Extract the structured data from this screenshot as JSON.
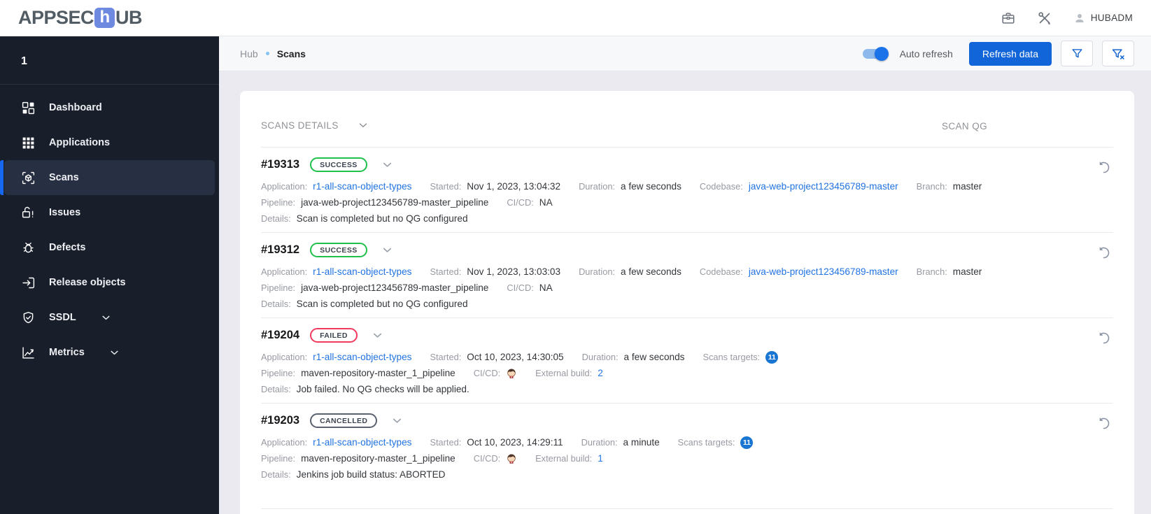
{
  "header": {
    "logo_pre": "APPSEC",
    "logo_mid": "h",
    "logo_post": "UB",
    "user": "HUBADM"
  },
  "sidebar": {
    "workspace": "1",
    "items": [
      {
        "label": "Dashboard",
        "icon": "dashboard-icon",
        "active": false,
        "expandable": false
      },
      {
        "label": "Applications",
        "icon": "applications-icon",
        "active": false,
        "expandable": false
      },
      {
        "label": "Scans",
        "icon": "scans-icon",
        "active": true,
        "expandable": false
      },
      {
        "label": "Issues",
        "icon": "issues-icon",
        "active": false,
        "expandable": false
      },
      {
        "label": "Defects",
        "icon": "defects-icon",
        "active": false,
        "expandable": false
      },
      {
        "label": "Release objects",
        "icon": "release-objects-icon",
        "active": false,
        "expandable": false
      },
      {
        "label": "SSDL",
        "icon": "ssdl-icon",
        "active": false,
        "expandable": true
      },
      {
        "label": "Metrics",
        "icon": "metrics-icon",
        "active": false,
        "expandable": true
      }
    ]
  },
  "topbar": {
    "breadcrumb_root": "Hub",
    "breadcrumb_current": "Scans",
    "auto_refresh_label": "Auto refresh",
    "auto_refresh_on": true,
    "refresh_button": "Refresh data"
  },
  "colors": {
    "accent_blue": "#1165d8",
    "link_blue": "#2173e2",
    "success": "#1fc14b",
    "failed": "#f23a5e",
    "cancelled": "#59626e",
    "targets_badge": "#1976d2"
  },
  "table": {
    "header_left": "SCANS DETAILS",
    "header_right": "SCAN QG",
    "rows": [
      {
        "id": "#19313",
        "status": "SUCCESS",
        "status_type": "success",
        "line1": [
          {
            "label": "Application:",
            "value": "r1-all-scan-object-types",
            "type": "link"
          },
          {
            "label": "Started:",
            "value": "Nov 1, 2023, 13:04:32",
            "type": "text"
          },
          {
            "label": "Duration:",
            "value": "a few seconds",
            "type": "text"
          },
          {
            "label": "Codebase:",
            "value": "java-web-project123456789-master",
            "type": "link"
          },
          {
            "label": "Branch:",
            "value": "master",
            "type": "text"
          }
        ],
        "line2": [
          {
            "label": "Pipeline:",
            "value": "java-web-project123456789-master_pipeline",
            "type": "text"
          },
          {
            "label": "CI/CD:",
            "value": "NA",
            "type": "text"
          }
        ],
        "details": {
          "label": "Details:",
          "value": "Scan is completed but no QG configured"
        }
      },
      {
        "id": "#19312",
        "status": "SUCCESS",
        "status_type": "success",
        "line1": [
          {
            "label": "Application:",
            "value": "r1-all-scan-object-types",
            "type": "link"
          },
          {
            "label": "Started:",
            "value": "Nov 1, 2023, 13:03:03",
            "type": "text"
          },
          {
            "label": "Duration:",
            "value": "a few seconds",
            "type": "text"
          },
          {
            "label": "Codebase:",
            "value": "java-web-project123456789-master",
            "type": "link"
          },
          {
            "label": "Branch:",
            "value": "master",
            "type": "text"
          }
        ],
        "line2": [
          {
            "label": "Pipeline:",
            "value": "java-web-project123456789-master_pipeline",
            "type": "text"
          },
          {
            "label": "CI/CD:",
            "value": "NA",
            "type": "text"
          }
        ],
        "details": {
          "label": "Details:",
          "value": "Scan is completed but no QG configured"
        }
      },
      {
        "id": "#19204",
        "status": "FAILED",
        "status_type": "failed",
        "line1": [
          {
            "label": "Application:",
            "value": "r1-all-scan-object-types",
            "type": "link"
          },
          {
            "label": "Started:",
            "value": "Oct 10, 2023, 14:30:05",
            "type": "text"
          },
          {
            "label": "Duration:",
            "value": "a few seconds",
            "type": "text"
          },
          {
            "label": "Scans targets:",
            "value": "11",
            "type": "count"
          }
        ],
        "line2": [
          {
            "label": "Pipeline:",
            "value": "maven-repository-master_1_pipeline",
            "type": "text"
          },
          {
            "label": "CI/CD:",
            "value": "",
            "type": "jenkins"
          },
          {
            "label": "External build:",
            "value": "2",
            "type": "link"
          }
        ],
        "details": {
          "label": "Details:",
          "value": "Job failed. No QG checks will be applied."
        }
      },
      {
        "id": "#19203",
        "status": "CANCELLED",
        "status_type": "cancelled",
        "line1": [
          {
            "label": "Application:",
            "value": "r1-all-scan-object-types",
            "type": "link"
          },
          {
            "label": "Started:",
            "value": "Oct 10, 2023, 14:29:11",
            "type": "text"
          },
          {
            "label": "Duration:",
            "value": "a minute",
            "type": "text"
          },
          {
            "label": "Scans targets:",
            "value": "11",
            "type": "count"
          }
        ],
        "line2": [
          {
            "label": "Pipeline:",
            "value": "maven-repository-master_1_pipeline",
            "type": "text"
          },
          {
            "label": "CI/CD:",
            "value": "",
            "type": "jenkins"
          },
          {
            "label": "External build:",
            "value": "1",
            "type": "link"
          }
        ],
        "details": {
          "label": "Details:",
          "value": "Jenkins job build status: ABORTED"
        }
      }
    ]
  }
}
